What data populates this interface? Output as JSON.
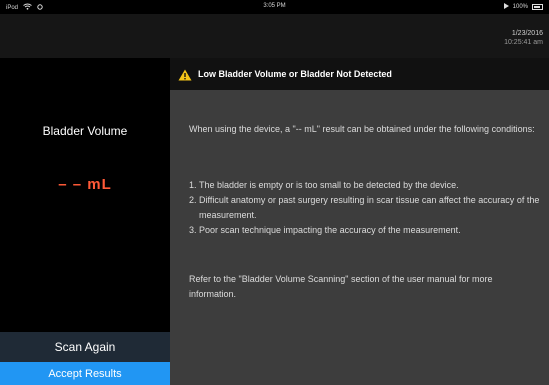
{
  "status_bar": {
    "device": "iPod",
    "time": "3:05 PM",
    "battery": "100%"
  },
  "header": {
    "date": "1/23/2016",
    "time": "10:25:41 am"
  },
  "left_panel": {
    "volume_label": "Bladder Volume",
    "volume_value": "– –  mL",
    "scan_again_label": "Scan Again",
    "accept_label": "Accept Results"
  },
  "alert": {
    "title": "Low Bladder Volume or Bladder Not Detected",
    "intro": "When using the device, a \"-- mL\" result can be obtained under the following conditions:",
    "conditions": [
      {
        "num": "1.",
        "text": "The bladder is empty or is too small to be detected by the device."
      },
      {
        "num": "2.",
        "text": "Difficult anatomy or past surgery resulting in scar tissue can affect the accuracy of the measurement."
      },
      {
        "num": "3.",
        "text": "Poor scan technique impacting the accuracy of the measurement."
      }
    ],
    "footer": "Refer to the \"Bladder Volume Scanning\" section of the user manual for more information."
  },
  "colors": {
    "accent_blue": "#2196f3",
    "volume_orange": "#ff5a38",
    "warning_yellow": "#f5c518"
  },
  "icons": {
    "alert": "warning-triangle-icon",
    "wifi": "wifi-icon",
    "battery": "battery-icon"
  }
}
